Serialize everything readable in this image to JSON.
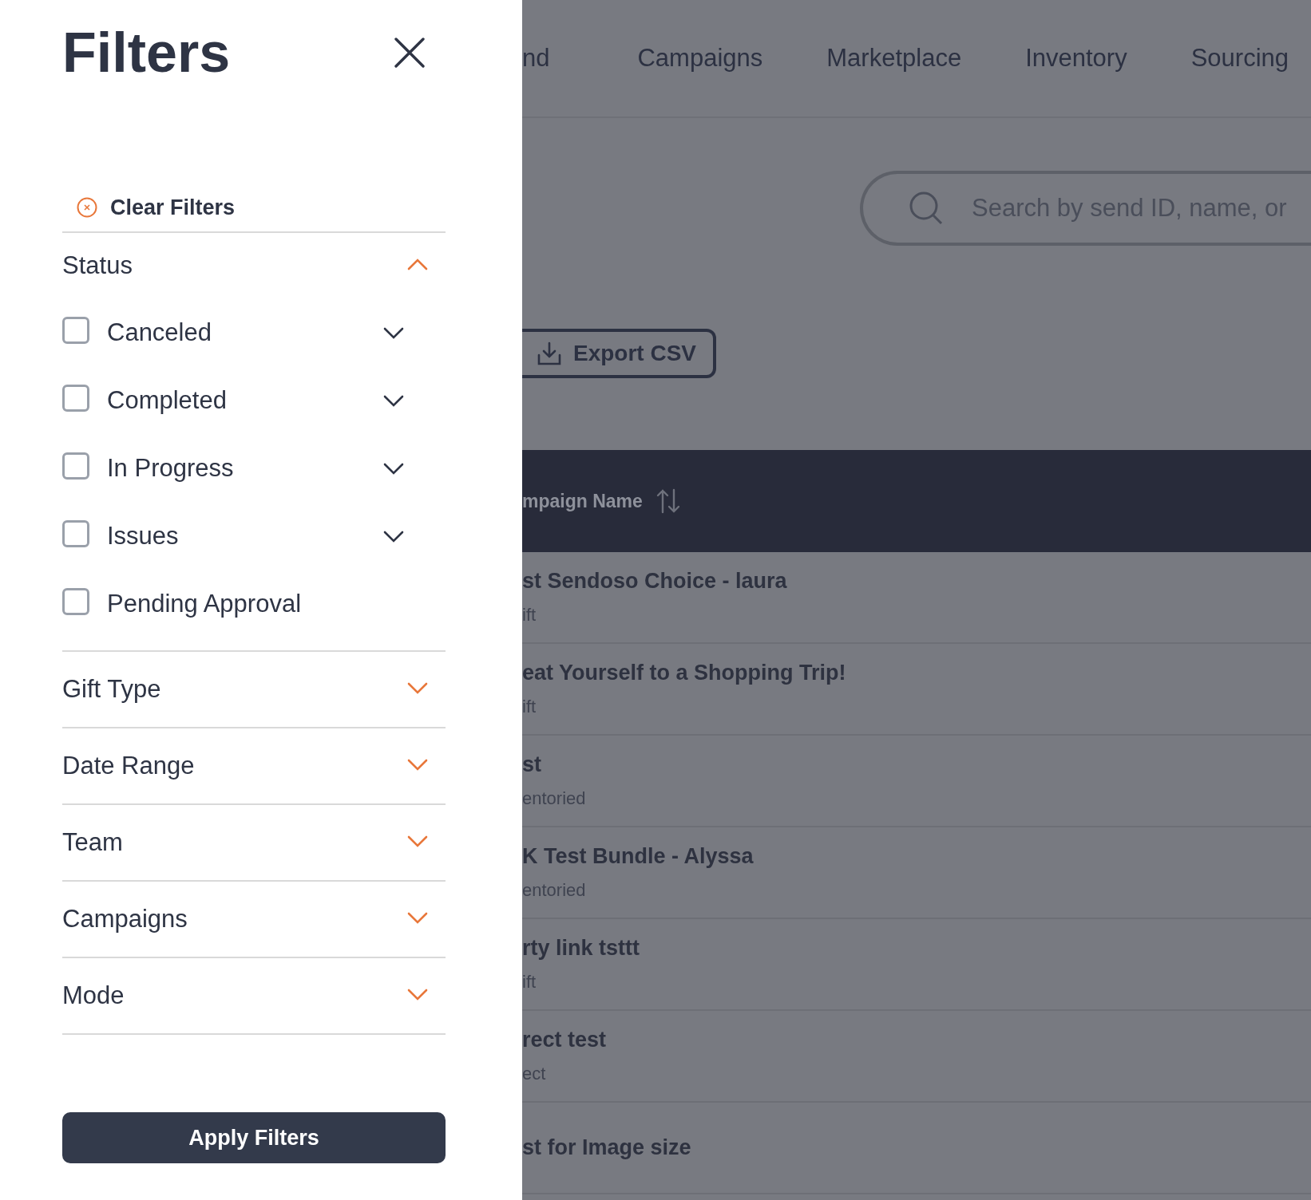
{
  "filters_panel": {
    "title": "Filters",
    "clear_button": "Clear Filters",
    "sections": [
      {
        "label": "Status",
        "expanded": true,
        "options": [
          {
            "label": "Canceled",
            "checked": false,
            "expandable": true
          },
          {
            "label": "Completed",
            "checked": false,
            "expandable": true
          },
          {
            "label": "In Progress",
            "checked": false,
            "expandable": true
          },
          {
            "label": "Issues",
            "checked": false,
            "expandable": true
          },
          {
            "label": "Pending Approval",
            "checked": false,
            "expandable": false
          }
        ]
      },
      {
        "label": "Gift Type",
        "expanded": false
      },
      {
        "label": "Date Range",
        "expanded": false
      },
      {
        "label": "Team",
        "expanded": false
      },
      {
        "label": "Campaigns",
        "expanded": false
      },
      {
        "label": "Mode",
        "expanded": false
      }
    ],
    "apply_button": "Apply Filters"
  },
  "background_page": {
    "nav": [
      {
        "label": "nd"
      },
      {
        "label": "Campaigns"
      },
      {
        "label": "Marketplace"
      },
      {
        "label": "Inventory"
      },
      {
        "label": "Sourcing"
      }
    ],
    "search": {
      "placeholder": "Search by send ID, name, or"
    },
    "export_button": "Export CSV",
    "table": {
      "columns": [
        "mpaign Name"
      ],
      "rows": [
        {
          "name": "st Sendoso Choice - laura",
          "type": "ift"
        },
        {
          "name": "eat Yourself to a Shopping Trip!",
          "type": "ift"
        },
        {
          "name": "st",
          "type": "entoried"
        },
        {
          "name": "K Test Bundle - Alyssa",
          "type": "entoried"
        },
        {
          "name": "rty link tsttt",
          "type": "ift"
        },
        {
          "name": "rect test",
          "type": "ect"
        },
        {
          "name": "st for Image size"
        }
      ]
    }
  }
}
